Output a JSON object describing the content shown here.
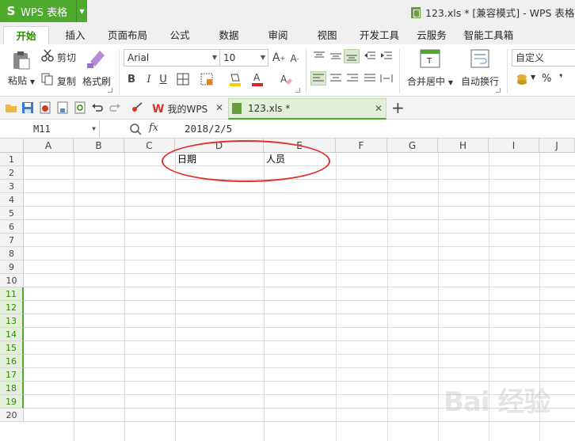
{
  "app": {
    "name": "WPS 表格",
    "logo": "S"
  },
  "window": {
    "title": "123.xls * [兼容模式] - WPS 表格"
  },
  "menu_tabs": [
    "开始",
    "插入",
    "页面布局",
    "公式",
    "数据",
    "审阅",
    "视图",
    "开发工具",
    "云服务",
    "智能工具箱"
  ],
  "ribbon": {
    "paste": "粘贴",
    "cut": "剪切",
    "copy": "复制",
    "format_painter": "格式刷",
    "font_name": "Arial",
    "font_size": "10",
    "merge_center": "合并居中",
    "wrap_text": "自动换行",
    "number_format": "自定义",
    "percent": "%",
    "comma": "❜"
  },
  "doc_tabs": [
    {
      "label": "我的WPS"
    },
    {
      "label": "123.xls *"
    }
  ],
  "formula_bar": {
    "name_box": "M11",
    "fx": "fx",
    "content": "2018/2/5"
  },
  "columns": [
    "A",
    "B",
    "C",
    "D",
    "E",
    "F",
    "G",
    "H",
    "I",
    "J"
  ],
  "rows": [
    "1",
    "2",
    "3",
    "4",
    "5",
    "6",
    "7",
    "8",
    "9",
    "10",
    "11",
    "12",
    "13",
    "14",
    "15",
    "16",
    "17",
    "18",
    "19",
    "20"
  ],
  "highlighted_rows": [
    "11",
    "12",
    "13",
    "14",
    "15",
    "16",
    "17",
    "18",
    "19"
  ],
  "cells": {
    "D1": "日期",
    "E1": "人员"
  },
  "watermark": "Bai 经验",
  "colors": {
    "accent": "#4eaa2c",
    "annotation": "#e03030"
  }
}
